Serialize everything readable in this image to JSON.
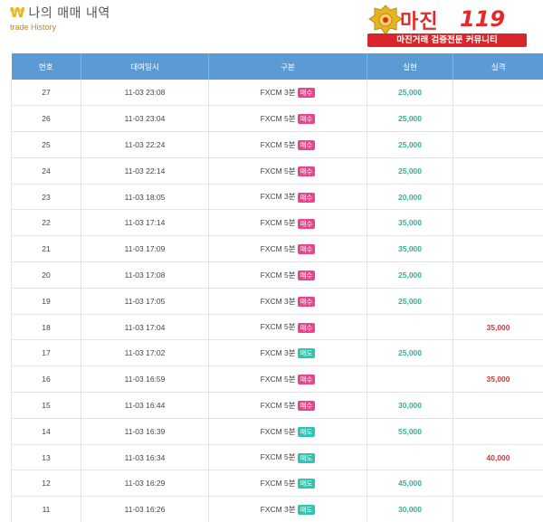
{
  "header": {
    "title": "나의 매매 내역",
    "subtitle": "trade History",
    "logo_name": "마진",
    "logo_num": "119",
    "logo_banner": "마진거래 검증전문 커뮤니티"
  },
  "colors": {
    "buy": "#e8458f",
    "sell": "#2ec4b0",
    "win": "#3cae94",
    "loss": "#c9393a",
    "header_bg": "#5b9bd5"
  },
  "table": {
    "columns": [
      "번호",
      "대여일시",
      "구분",
      "실현",
      "실격"
    ],
    "rows": [
      {
        "no": "27",
        "datetime": "11-03 23:08",
        "product": "FXCM 3분",
        "side": "매수",
        "side_type": "buy",
        "win": "25,000",
        "loss": ""
      },
      {
        "no": "26",
        "datetime": "11-03 23:04",
        "product": "FXCM 5분",
        "side": "매수",
        "side_type": "buy",
        "win": "25,000",
        "loss": ""
      },
      {
        "no": "25",
        "datetime": "11-03 22:24",
        "product": "FXCM 5분",
        "side": "매수",
        "side_type": "buy",
        "win": "25,000",
        "loss": ""
      },
      {
        "no": "24",
        "datetime": "11-03 22:14",
        "product": "FXCM 5분",
        "side": "매수",
        "side_type": "buy",
        "win": "25,000",
        "loss": ""
      },
      {
        "no": "23",
        "datetime": "11-03 18:05",
        "product": "FXCM 3분",
        "side": "매수",
        "side_type": "buy",
        "win": "20,000",
        "loss": ""
      },
      {
        "no": "22",
        "datetime": "11-03 17:14",
        "product": "FXCM 5분",
        "side": "매수",
        "side_type": "buy",
        "win": "35,000",
        "loss": ""
      },
      {
        "no": "21",
        "datetime": "11-03 17:09",
        "product": "FXCM 5분",
        "side": "매수",
        "side_type": "buy",
        "win": "35,000",
        "loss": ""
      },
      {
        "no": "20",
        "datetime": "11-03 17:08",
        "product": "FXCM 5분",
        "side": "매수",
        "side_type": "buy",
        "win": "25,000",
        "loss": ""
      },
      {
        "no": "19",
        "datetime": "11-03 17:05",
        "product": "FXCM 3분",
        "side": "매수",
        "side_type": "buy",
        "win": "25,000",
        "loss": ""
      },
      {
        "no": "18",
        "datetime": "11-03 17:04",
        "product": "FXCM 5분",
        "side": "매수",
        "side_type": "buy",
        "win": "",
        "loss": "35,000"
      },
      {
        "no": "17",
        "datetime": "11-03 17:02",
        "product": "FXCM 3분",
        "side": "매도",
        "side_type": "sell",
        "win": "25,000",
        "loss": ""
      },
      {
        "no": "16",
        "datetime": "11-03 16:59",
        "product": "FXCM 5분",
        "side": "매수",
        "side_type": "buy",
        "win": "",
        "loss": "35,000"
      },
      {
        "no": "15",
        "datetime": "11-03 16:44",
        "product": "FXCM 5분",
        "side": "매수",
        "side_type": "buy",
        "win": "30,000",
        "loss": ""
      },
      {
        "no": "14",
        "datetime": "11-03 16:39",
        "product": "FXCM 5분",
        "side": "매도",
        "side_type": "sell",
        "win": "55,000",
        "loss": ""
      },
      {
        "no": "13",
        "datetime": "11-03 16:34",
        "product": "FXCM 5분",
        "side": "매도",
        "side_type": "sell",
        "win": "",
        "loss": "40,000"
      },
      {
        "no": "12",
        "datetime": "11-03 16:29",
        "product": "FXCM 5분",
        "side": "매도",
        "side_type": "sell",
        "win": "45,000",
        "loss": ""
      },
      {
        "no": "11",
        "datetime": "11-03 16:26",
        "product": "FXCM 3분",
        "side": "매도",
        "side_type": "sell",
        "win": "30,000",
        "loss": ""
      }
    ]
  }
}
